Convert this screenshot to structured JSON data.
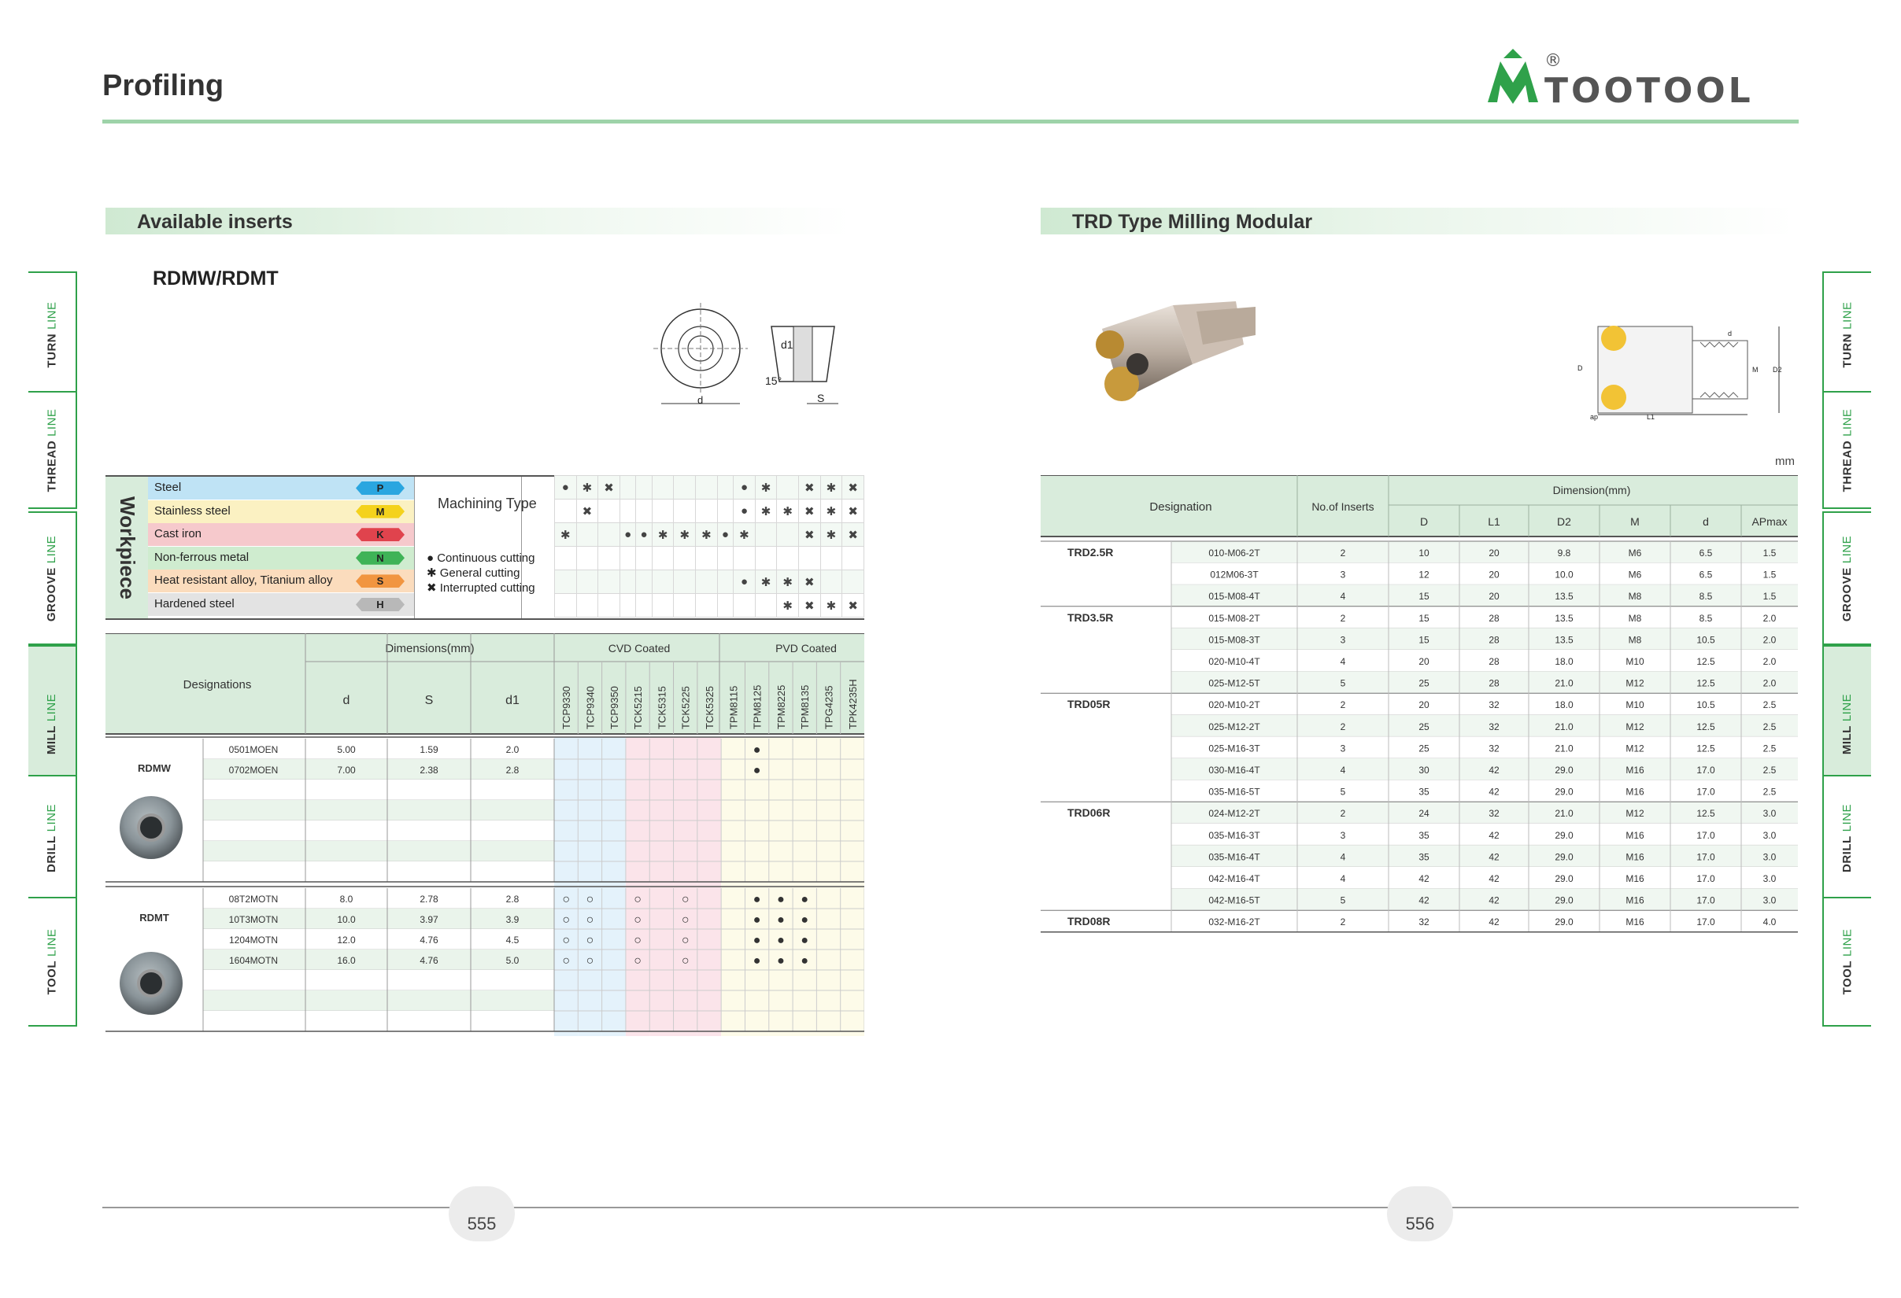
{
  "page_title": "Profiling",
  "brand": {
    "name": "TOOTOOL",
    "registered": "®",
    "color": "#2fa14a"
  },
  "left": {
    "section_title": "Available inserts",
    "subtitle": "RDMW/RDMT",
    "drawing_labels": {
      "d": "d",
      "d1": "d1",
      "angle": "15°",
      "s": "S"
    },
    "workpiece_label": "Workpiece",
    "workpieces": [
      {
        "name": "Steel",
        "code": "P",
        "color": "#2aa6e0",
        "bg": "#bfe3f5"
      },
      {
        "name": "Stainless steel",
        "code": "M",
        "color": "#f4d21c",
        "bg": "#fbf1c2"
      },
      {
        "name": "Cast iron",
        "code": "K",
        "color": "#e0434d",
        "bg": "#f6c9cc"
      },
      {
        "name": "Non-ferrous metal",
        "code": "N",
        "color": "#3fb357",
        "bg": "#cfeccf"
      },
      {
        "name": "Heat resistant alloy, Titanium alloy",
        "code": "S",
        "color": "#f19540",
        "bg": "#fbdcbd"
      },
      {
        "name": "Hardened steel",
        "code": "H",
        "color": "#b8b8b8",
        "bg": "#e3e3e3"
      }
    ],
    "machining_type_label": "Machining Type",
    "legend": [
      "● Continuous cutting",
      "✱ General cutting",
      "✖ Interrupted cutting"
    ],
    "machining_marks": [
      [
        "●",
        "✱",
        "✖",
        "",
        "",
        "",
        "",
        "",
        "",
        "●",
        "✱",
        "",
        "✖",
        "✱",
        "✖"
      ],
      [
        "",
        "✖",
        "",
        "",
        "",
        "",
        "",
        "",
        "",
        "●",
        "✱",
        "✱",
        "✖",
        "✱",
        "✖"
      ],
      [
        "✱",
        "",
        "",
        "●",
        "●",
        "✱",
        "✱",
        "✱",
        "●",
        "✱",
        "",
        "",
        "✖",
        "✱",
        "✖"
      ],
      [
        "",
        "",
        "",
        "",
        "",
        "",
        "",
        "",
        "",
        "",
        "",
        "",
        "",
        "",
        ""
      ],
      [
        "",
        "",
        "",
        "",
        "",
        "",
        "",
        "",
        "",
        "●",
        "✱",
        "✱",
        "✖",
        "",
        ""
      ],
      [
        "",
        "",
        "",
        "",
        "",
        "",
        "",
        "",
        "",
        "",
        "",
        "✱",
        "✖",
        "✱",
        "✖"
      ]
    ],
    "table_headers": {
      "designations": "Designations",
      "dimensions": "Dimensions(mm)",
      "d": "d",
      "s": "S",
      "d1": "d1",
      "cvd": "CVD Coated",
      "pvd": "PVD Coated"
    },
    "grades": [
      "TCP9330",
      "TCP9340",
      "TCP9350",
      "TCK5215",
      "TCK5315",
      "TCK5225",
      "TCK5325",
      "TPM8115",
      "TPM8125",
      "TPM8225",
      "TPM8135",
      "TPG4235",
      "TPK4235H"
    ],
    "groups": [
      {
        "name": "RDMW",
        "rows": [
          {
            "des": "0501MOEN",
            "d": "5.00",
            "s": "1.59",
            "d1": "2.0",
            "marks": [
              "",
              "",
              "",
              "",
              "",
              "",
              "",
              "",
              "●",
              "",
              "",
              "",
              ""
            ]
          },
          {
            "des": "0702MOEN",
            "d": "7.00",
            "s": "2.38",
            "d1": "2.8",
            "marks": [
              "",
              "",
              "",
              "",
              "",
              "",
              "",
              "",
              "●",
              "",
              "",
              "",
              ""
            ]
          }
        ]
      },
      {
        "name": "RDMT",
        "rows": [
          {
            "des": "08T2MOTN",
            "d": "8.0",
            "s": "2.78",
            "d1": "2.8",
            "marks": [
              "○",
              "○",
              "",
              "○",
              "",
              "○",
              "",
              "",
              "●",
              "●",
              "●",
              "",
              ""
            ]
          },
          {
            "des": "10T3MOTN",
            "d": "10.0",
            "s": "3.97",
            "d1": "3.9",
            "marks": [
              "○",
              "○",
              "",
              "○",
              "",
              "○",
              "",
              "",
              "●",
              "●",
              "●",
              "",
              ""
            ]
          },
          {
            "des": "1204MOTN",
            "d": "12.0",
            "s": "4.76",
            "d1": "4.5",
            "marks": [
              "○",
              "○",
              "",
              "○",
              "",
              "○",
              "",
              "",
              "●",
              "●",
              "●",
              "",
              ""
            ]
          },
          {
            "des": "1604MOTN",
            "d": "16.0",
            "s": "4.76",
            "d1": "5.0",
            "marks": [
              "○",
              "○",
              "",
              "○",
              "",
              "○",
              "",
              "",
              "●",
              "●",
              "●",
              "",
              ""
            ]
          }
        ]
      }
    ],
    "page_number": "555"
  },
  "right": {
    "section_title": "TRD Type Milling Modular",
    "unit": "mm",
    "drawing_labels": {
      "d": "d",
      "D": "D",
      "D2": "D2",
      "M": "M",
      "L1": "L1",
      "ap": "ap"
    },
    "headers": {
      "designation": "Designation",
      "inserts": "No.of Inserts",
      "dimension": "Dimension(mm)",
      "cols": [
        "D",
        "L1",
        "D2",
        "M",
        "d",
        "APmax"
      ]
    },
    "rows": [
      {
        "series": "TRD2.5R",
        "code": "010-M06-2T",
        "n": "2",
        "D": "10",
        "L1": "20",
        "D2": "9.8",
        "M": "M6",
        "d": "6.5",
        "ap": "1.5"
      },
      {
        "series": "",
        "code": "012M06-3T",
        "n": "3",
        "D": "12",
        "L1": "20",
        "D2": "10.0",
        "M": "M6",
        "d": "6.5",
        "ap": "1.5"
      },
      {
        "series": "",
        "code": "015-M08-4T",
        "n": "4",
        "D": "15",
        "L1": "20",
        "D2": "13.5",
        "M": "M8",
        "d": "8.5",
        "ap": "1.5"
      },
      {
        "series": "TRD3.5R",
        "code": "015-M08-2T",
        "n": "2",
        "D": "15",
        "L1": "28",
        "D2": "13.5",
        "M": "M8",
        "d": "8.5",
        "ap": "2.0"
      },
      {
        "series": "",
        "code": "015-M08-3T",
        "n": "3",
        "D": "15",
        "L1": "28",
        "D2": "13.5",
        "M": "M8",
        "d": "10.5",
        "ap": "2.0"
      },
      {
        "series": "",
        "code": "020-M10-4T",
        "n": "4",
        "D": "20",
        "L1": "28",
        "D2": "18.0",
        "M": "M10",
        "d": "12.5",
        "ap": "2.0"
      },
      {
        "series": "",
        "code": "025-M12-5T",
        "n": "5",
        "D": "25",
        "L1": "28",
        "D2": "21.0",
        "M": "M12",
        "d": "12.5",
        "ap": "2.0"
      },
      {
        "series": "TRD05R",
        "code": "020-M10-2T",
        "n": "2",
        "D": "20",
        "L1": "32",
        "D2": "18.0",
        "M": "M10",
        "d": "10.5",
        "ap": "2.5"
      },
      {
        "series": "",
        "code": "025-M12-2T",
        "n": "2",
        "D": "25",
        "L1": "32",
        "D2": "21.0",
        "M": "M12",
        "d": "12.5",
        "ap": "2.5"
      },
      {
        "series": "",
        "code": "025-M16-3T",
        "n": "3",
        "D": "25",
        "L1": "32",
        "D2": "21.0",
        "M": "M12",
        "d": "12.5",
        "ap": "2.5"
      },
      {
        "series": "",
        "code": "030-M16-4T",
        "n": "4",
        "D": "30",
        "L1": "42",
        "D2": "29.0",
        "M": "M16",
        "d": "17.0",
        "ap": "2.5"
      },
      {
        "series": "",
        "code": "035-M16-5T",
        "n": "5",
        "D": "35",
        "L1": "42",
        "D2": "29.0",
        "M": "M16",
        "d": "17.0",
        "ap": "2.5"
      },
      {
        "series": "TRD06R",
        "code": "024-M12-2T",
        "n": "2",
        "D": "24",
        "L1": "32",
        "D2": "21.0",
        "M": "M12",
        "d": "12.5",
        "ap": "3.0"
      },
      {
        "series": "",
        "code": "035-M16-3T",
        "n": "3",
        "D": "35",
        "L1": "42",
        "D2": "29.0",
        "M": "M16",
        "d": "17.0",
        "ap": "3.0"
      },
      {
        "series": "",
        "code": "035-M16-4T",
        "n": "4",
        "D": "35",
        "L1": "42",
        "D2": "29.0",
        "M": "M16",
        "d": "17.0",
        "ap": "3.0"
      },
      {
        "series": "",
        "code": "042-M16-4T",
        "n": "4",
        "D": "42",
        "L1": "42",
        "D2": "29.0",
        "M": "M16",
        "d": "17.0",
        "ap": "3.0"
      },
      {
        "series": "",
        "code": "042-M16-5T",
        "n": "5",
        "D": "42",
        "L1": "42",
        "D2": "29.0",
        "M": "M16",
        "d": "17.0",
        "ap": "3.0"
      },
      {
        "series": "TRD08R",
        "code": "032-M16-2T",
        "n": "2",
        "D": "32",
        "L1": "42",
        "D2": "29.0",
        "M": "M16",
        "d": "17.0",
        "ap": "4.0"
      }
    ],
    "page_number": "556"
  },
  "side_tabs": [
    {
      "main": "TURN",
      "sub": "LINE"
    },
    {
      "main": "THREAD",
      "sub": "LINE"
    },
    {
      "main": "GROOVE",
      "sub": "LINE"
    },
    {
      "main": "MILL",
      "sub": "LINE"
    },
    {
      "main": "DRILL",
      "sub": "LINE"
    },
    {
      "main": "TOOL",
      "sub": "LINE"
    }
  ]
}
